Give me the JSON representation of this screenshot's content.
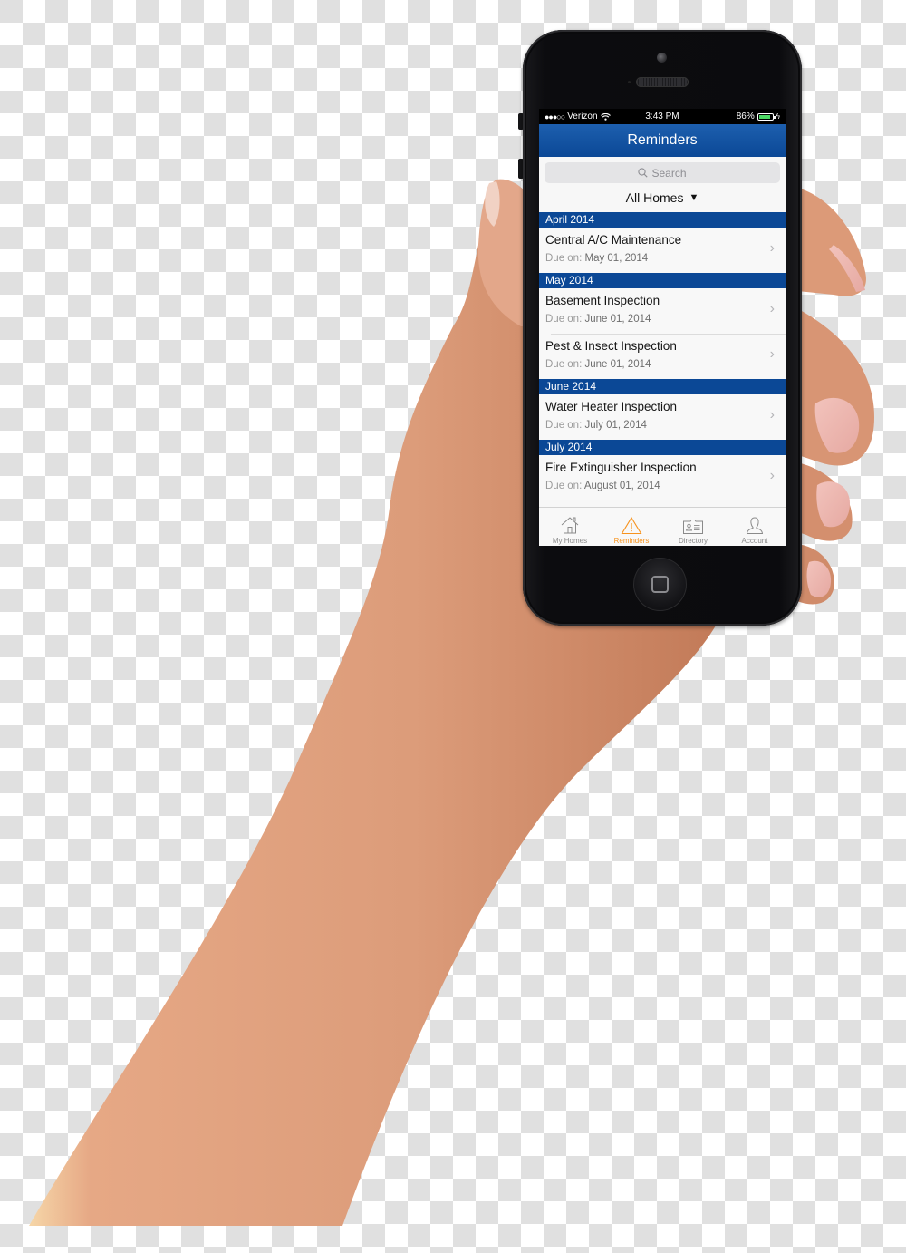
{
  "statusbar": {
    "carrier": "Verizon",
    "signal_dots": "●●●○○",
    "time": "3:43 PM",
    "battery_percent": "86%",
    "battery_level": 0.86,
    "battery_color": "#4cd964"
  },
  "navbar": {
    "title": "Reminders",
    "color": "#0b4896"
  },
  "search": {
    "placeholder": "Search"
  },
  "filter": {
    "label": "All Homes",
    "icon": "triangle-down-icon"
  },
  "sections": [
    {
      "header": "April 2014",
      "items": [
        {
          "title": "Central A/C Maintenance",
          "due_label": "Due on:",
          "due_date": "May 01, 2014"
        }
      ]
    },
    {
      "header": "May 2014",
      "items": [
        {
          "title": "Basement Inspection",
          "due_label": "Due on:",
          "due_date": "June 01, 2014"
        },
        {
          "title": "Pest & Insect Inspection",
          "due_label": "Due on:",
          "due_date": "June 01, 2014"
        }
      ]
    },
    {
      "header": "June 2014",
      "items": [
        {
          "title": "Water Heater Inspection",
          "due_label": "Due on:",
          "due_date": "July 01, 2014"
        }
      ]
    },
    {
      "header": "July 2014",
      "items": [
        {
          "title": "Fire Extinguisher Inspection",
          "due_label": "Due on:",
          "due_date": "August 01, 2014"
        }
      ]
    }
  ],
  "tabbar": {
    "active_color": "#f7931e",
    "tabs": [
      {
        "label": "My Homes",
        "icon": "house-icon",
        "active": false
      },
      {
        "label": "Reminders",
        "icon": "warning-triangle-icon",
        "active": true
      },
      {
        "label": "Directory",
        "icon": "contact-card-icon",
        "active": false
      },
      {
        "label": "Account",
        "icon": "person-icon",
        "active": false
      }
    ]
  }
}
